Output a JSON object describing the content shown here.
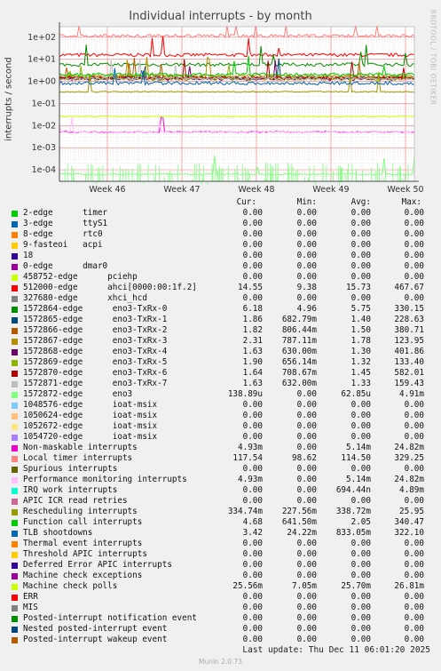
{
  "chart_data": {
    "type": "line",
    "title": "Individual interrupts - by month",
    "ylabel": "interrupts / second",
    "yscale": "log",
    "ylim": [
      3e-05,
      300
    ],
    "yticks": [
      "1e+02",
      "1e+01",
      "1e+00",
      "1e-01",
      "1e-02",
      "1e-03",
      "1e-04"
    ],
    "xticks": [
      "Week 46",
      "Week 47",
      "Week 48",
      "Week 49",
      "Week 50"
    ],
    "grid": true,
    "columns": [
      "Cur:",
      "Min:",
      "Avg:",
      "Max:"
    ],
    "series": [
      {
        "name": "2-edge      timer",
        "color": "#00cc00",
        "cur": "0.00",
        "min": "0.00",
        "avg": "0.00",
        "max": "0.00"
      },
      {
        "name": "3-edge      ttyS1",
        "color": "#0066b3",
        "cur": "0.00",
        "min": "0.00",
        "avg": "0.00",
        "max": "0.00"
      },
      {
        "name": "8-edge      rtc0",
        "color": "#ff8000",
        "cur": "0.00",
        "min": "0.00",
        "avg": "0.00",
        "max": "0.00"
      },
      {
        "name": "9-fasteoi   acpi",
        "color": "#ffcc00",
        "cur": "0.00",
        "min": "0.00",
        "avg": "0.00",
        "max": "0.00"
      },
      {
        "name": "18",
        "color": "#330099",
        "cur": "0.00",
        "min": "0.00",
        "avg": "0.00",
        "max": "0.00"
      },
      {
        "name": "0-edge      dmar0",
        "color": "#990099",
        "cur": "0.00",
        "min": "0.00",
        "avg": "0.00",
        "max": "0.00"
      },
      {
        "name": "458752-edge      pciehp",
        "color": "#ccff00",
        "cur": "0.00",
        "min": "0.00",
        "avg": "0.00",
        "max": "0.00"
      },
      {
        "name": "512000-edge      ahci[0000:00:1f.2]",
        "color": "#ff0000",
        "cur": "14.55",
        "min": "9.38",
        "avg": "15.73",
        "max": "467.67"
      },
      {
        "name": "327680-edge      xhci_hcd",
        "color": "#808080",
        "cur": "0.00",
        "min": "0.00",
        "avg": "0.00",
        "max": "0.00"
      },
      {
        "name": "1572864-edge      eno3-TxRx-0",
        "color": "#008f00",
        "cur": "6.18",
        "min": "4.96",
        "avg": "5.75",
        "max": "330.15"
      },
      {
        "name": "1572865-edge      eno3-TxRx-1",
        "color": "#00487d",
        "cur": "1.86",
        "min": "682.79m",
        "avg": "1.40",
        "max": "228.63"
      },
      {
        "name": "1572866-edge      eno3-TxRx-2",
        "color": "#b35a00",
        "cur": "1.82",
        "min": "806.44m",
        "avg": "1.50",
        "max": "380.71"
      },
      {
        "name": "1572867-edge      eno3-TxRx-3",
        "color": "#b38f00",
        "cur": "2.31",
        "min": "787.11m",
        "avg": "1.78",
        "max": "123.95"
      },
      {
        "name": "1572868-edge      eno3-TxRx-4",
        "color": "#6b006b",
        "cur": "1.63",
        "min": "630.00m",
        "avg": "1.30",
        "max": "401.86"
      },
      {
        "name": "1572869-edge      eno3-TxRx-5",
        "color": "#8fb300",
        "cur": "1.90",
        "min": "656.14m",
        "avg": "1.32",
        "max": "133.40"
      },
      {
        "name": "1572870-edge      eno3-TxRx-6",
        "color": "#b30000",
        "cur": "1.64",
        "min": "708.67m",
        "avg": "1.45",
        "max": "582.01"
      },
      {
        "name": "1572871-edge      eno3-TxRx-7",
        "color": "#bebebe",
        "cur": "1.63",
        "min": "632.00m",
        "avg": "1.33",
        "max": "159.43"
      },
      {
        "name": "1572872-edge      eno3",
        "color": "#80ff80",
        "cur": "138.89u",
        "min": "0.00",
        "avg": "62.85u",
        "max": "4.91m"
      },
      {
        "name": "1048576-edge      ioat-msix",
        "color": "#80c9ff",
        "cur": "0.00",
        "min": "0.00",
        "avg": "0.00",
        "max": "0.00"
      },
      {
        "name": "1050624-edge      ioat-msix",
        "color": "#ffc080",
        "cur": "0.00",
        "min": "0.00",
        "avg": "0.00",
        "max": "0.00"
      },
      {
        "name": "1052672-edge      ioat-msix",
        "color": "#ffe680",
        "cur": "0.00",
        "min": "0.00",
        "avg": "0.00",
        "max": "0.00"
      },
      {
        "name": "1054720-edge      ioat-msix",
        "color": "#aa80ff",
        "cur": "0.00",
        "min": "0.00",
        "avg": "0.00",
        "max": "0.00"
      },
      {
        "name": "Non-maskable interrupts",
        "color": "#ee00cc",
        "cur": "4.93m",
        "min": "0.00",
        "avg": "5.14m",
        "max": "24.82m"
      },
      {
        "name": "Local timer interrupts",
        "color": "#ff8080",
        "cur": "117.54",
        "min": "98.62",
        "avg": "114.50",
        "max": "329.25"
      },
      {
        "name": "Spurious interrupts",
        "color": "#666600",
        "cur": "0.00",
        "min": "0.00",
        "avg": "0.00",
        "max": "0.00"
      },
      {
        "name": "Performance monitoring interrupts",
        "color": "#ffbfff",
        "cur": "4.93m",
        "min": "0.00",
        "avg": "5.14m",
        "max": "24.82m"
      },
      {
        "name": "IRQ work interrupts",
        "color": "#00ffcc",
        "cur": "0.00",
        "min": "0.00",
        "avg": "694.44n",
        "max": "4.89m"
      },
      {
        "name": "APIC ICR read retries",
        "color": "#cc6699",
        "cur": "0.00",
        "min": "0.00",
        "avg": "0.00",
        "max": "0.00"
      },
      {
        "name": "Rescheduling interrupts",
        "color": "#999900",
        "cur": "334.74m",
        "min": "227.56m",
        "avg": "338.72m",
        "max": "25.95"
      },
      {
        "name": "Function call interrupts",
        "color": "#00cc00",
        "cur": "4.68",
        "min": "641.50m",
        "avg": "2.05",
        "max": "340.47"
      },
      {
        "name": "TLB shootdowns",
        "color": "#0066b3",
        "cur": "3.42",
        "min": "24.22m",
        "avg": "833.05m",
        "max": "322.10"
      },
      {
        "name": "Thermal event interrupts",
        "color": "#ff8000",
        "cur": "0.00",
        "min": "0.00",
        "avg": "0.00",
        "max": "0.00"
      },
      {
        "name": "Threshold APIC interrupts",
        "color": "#ffcc00",
        "cur": "0.00",
        "min": "0.00",
        "avg": "0.00",
        "max": "0.00"
      },
      {
        "name": "Deferred Error APIC interrupts",
        "color": "#330099",
        "cur": "0.00",
        "min": "0.00",
        "avg": "0.00",
        "max": "0.00"
      },
      {
        "name": "Machine check exceptions",
        "color": "#990099",
        "cur": "0.00",
        "min": "0.00",
        "avg": "0.00",
        "max": "0.00"
      },
      {
        "name": "Machine check polls",
        "color": "#ccff00",
        "cur": "25.56m",
        "min": "7.05m",
        "avg": "25.70m",
        "max": "26.81m"
      },
      {
        "name": "ERR",
        "color": "#ff0000",
        "cur": "0.00",
        "min": "0.00",
        "avg": "0.00",
        "max": "0.00"
      },
      {
        "name": "MIS",
        "color": "#808080",
        "cur": "0.00",
        "min": "0.00",
        "avg": "0.00",
        "max": "0.00"
      },
      {
        "name": "Posted-interrupt notification event",
        "color": "#008f00",
        "cur": "0.00",
        "min": "0.00",
        "avg": "0.00",
        "max": "0.00"
      },
      {
        "name": "Nested posted-interrupt event",
        "color": "#00487d",
        "cur": "0.00",
        "min": "0.00",
        "avg": "0.00",
        "max": "0.00"
      },
      {
        "name": "Posted-interrupt wakeup event",
        "color": "#b35a00",
        "cur": "0.00",
        "min": "0.00",
        "avg": "0.00",
        "max": "0.00"
      }
    ]
  },
  "side_label": "RRDTOOL / TOBI OETIKER",
  "last_update": "Last update: Thu Dec 11 06:01:20 2025",
  "footer": "Munin 2.0.73"
}
